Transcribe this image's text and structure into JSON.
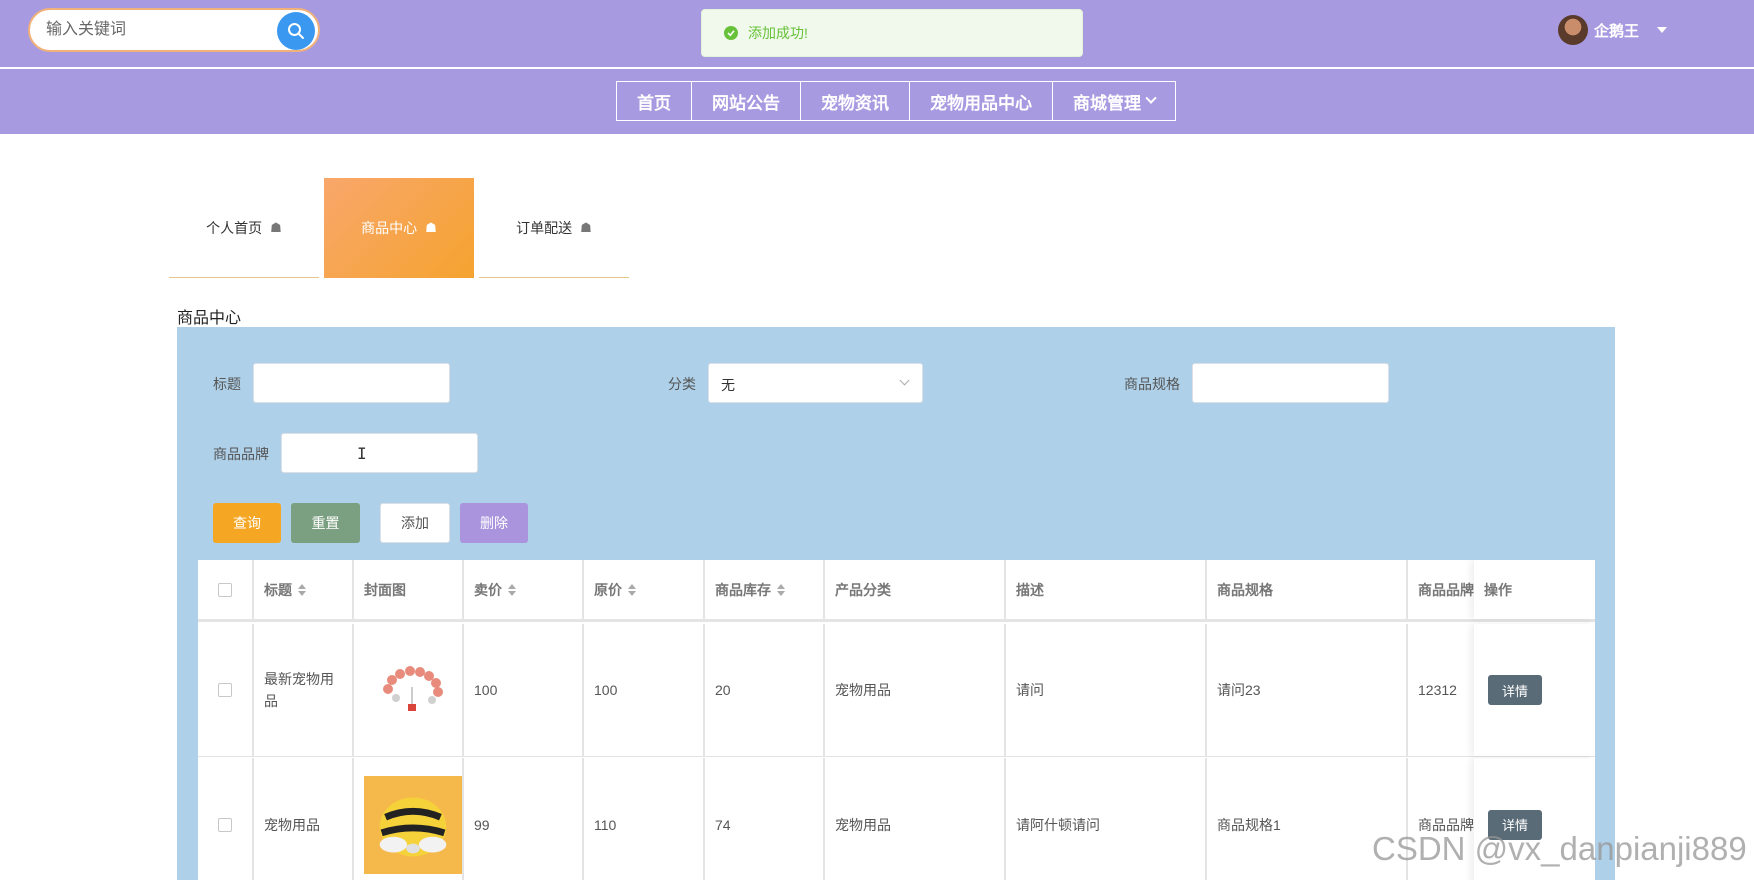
{
  "header": {
    "search_placeholder": "输入关键词",
    "toast_message": "添加成功!",
    "user_name": "企鹅王"
  },
  "nav": {
    "items": [
      {
        "label": "首页"
      },
      {
        "label": "网站公告"
      },
      {
        "label": "宠物资讯"
      },
      {
        "label": "宠物用品中心"
      },
      {
        "label": "商城管理"
      }
    ]
  },
  "tabs": [
    {
      "label": "个人首页",
      "active": false
    },
    {
      "label": "商品中心",
      "active": true
    },
    {
      "label": "订单配送",
      "active": false
    }
  ],
  "page_title": "商品中心",
  "filters": {
    "title_label": "标题",
    "title_value": "",
    "category_label": "分类",
    "category_value": "无",
    "spec_label": "商品规格",
    "spec_value": "",
    "brand_label": "商品品牌",
    "brand_value": ""
  },
  "actions": {
    "query": "查询",
    "reset": "重置",
    "add": "添加",
    "delete": "删除"
  },
  "table": {
    "columns": [
      "标题",
      "封面图",
      "卖价",
      "原价",
      "商品库存",
      "产品分类",
      "描述",
      "商品规格",
      "商品品牌",
      "操作"
    ],
    "rows": [
      {
        "title": "最新宠物用品",
        "price": "100",
        "original_price": "100",
        "stock": "20",
        "category": "宠物用品",
        "description": "请问",
        "spec": "请问23",
        "brand": "12312",
        "action": "详情"
      },
      {
        "title": "宠物用品",
        "price": "99",
        "original_price": "110",
        "stock": "74",
        "category": "宠物用品",
        "description": "请阿什顿请问",
        "spec": "商品规格1",
        "brand": "商品品牌",
        "action": "详情"
      }
    ]
  },
  "watermark": "CSDN @vx_danpianji889",
  "colors": {
    "header_bg": "#a89ae0",
    "tab_active": "#f5a32f",
    "panel_bg": "#aed0e8",
    "query_btn": "#f5a623",
    "reset_btn": "#7ba081",
    "delete_btn": "#a994dd",
    "detail_btn": "#5a6b78",
    "success": "#67c23a"
  }
}
